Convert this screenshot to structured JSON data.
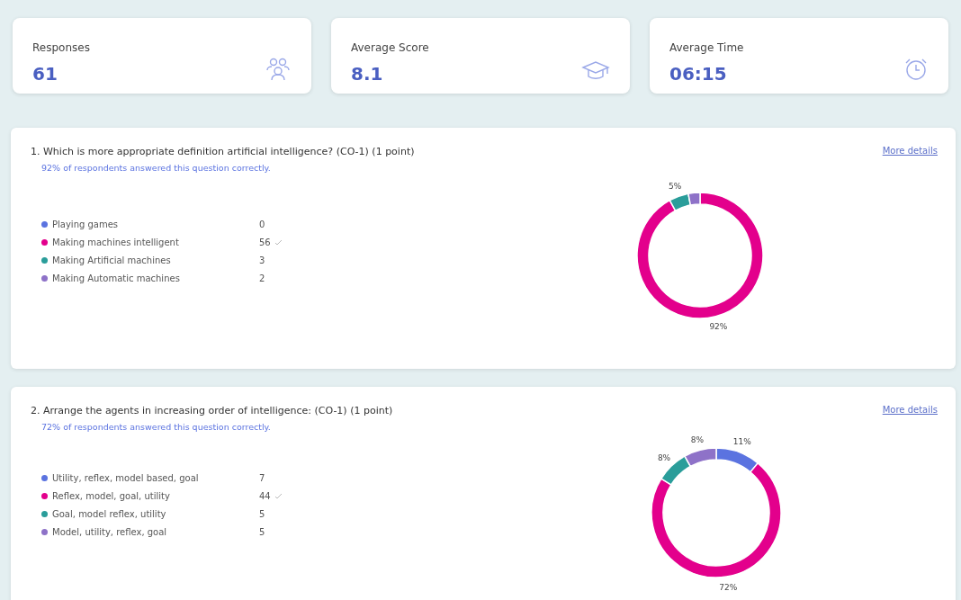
{
  "stats": [
    {
      "label": "Responses",
      "value": "61",
      "kind": "people"
    },
    {
      "label": "Average Score",
      "value": "8.1",
      "kind": "cap"
    },
    {
      "label": "Average Time",
      "value": "06:15",
      "kind": "clock"
    }
  ],
  "questions": [
    {
      "title": "1.  Which is more appropriate definition artificial intelligence? (CO-1) (1 point)",
      "summary": "92% of respondents answered this question correctly.",
      "link": "More details",
      "options": [
        {
          "label": "Playing games",
          "count": "0",
          "correct": false,
          "color": "#5b73e0"
        },
        {
          "label": "Making machines intelligent",
          "count": "56",
          "correct": true,
          "color": "#e3008c"
        },
        {
          "label": "Making Artificial machines",
          "count": "3",
          "correct": false,
          "color": "#2a9d9a"
        },
        {
          "label": "Making Automatic machines",
          "count": "2",
          "correct": false,
          "color": "#8e72c8"
        }
      ],
      "chart_data": {
        "type": "donut",
        "values": [
          0,
          92,
          5,
          3
        ],
        "value_labels": [
          null,
          "92%",
          "5%",
          null
        ]
      }
    },
    {
      "title": "2.  Arrange the agents in  increasing order of intelligence: (CO-1) (1 point)",
      "summary": "72% of respondents answered this question correctly.",
      "link": "More details",
      "options": [
        {
          "label": "Utility, reflex, model based, goal",
          "count": "7",
          "correct": false,
          "color": "#5b73e0"
        },
        {
          "label": "Reflex, model, goal, utility",
          "count": "44",
          "correct": true,
          "color": "#e3008c"
        },
        {
          "label": "Goal, model reflex, utility",
          "count": "5",
          "correct": false,
          "color": "#2a9d9a"
        },
        {
          "label": "Model, utility, reflex, goal",
          "count": "5",
          "correct": false,
          "color": "#8e72c8"
        }
      ],
      "chart_data": {
        "type": "donut",
        "values": [
          11,
          72,
          8,
          8
        ],
        "value_labels": [
          "11%",
          "72%",
          "8%",
          "8%"
        ]
      }
    }
  ]
}
